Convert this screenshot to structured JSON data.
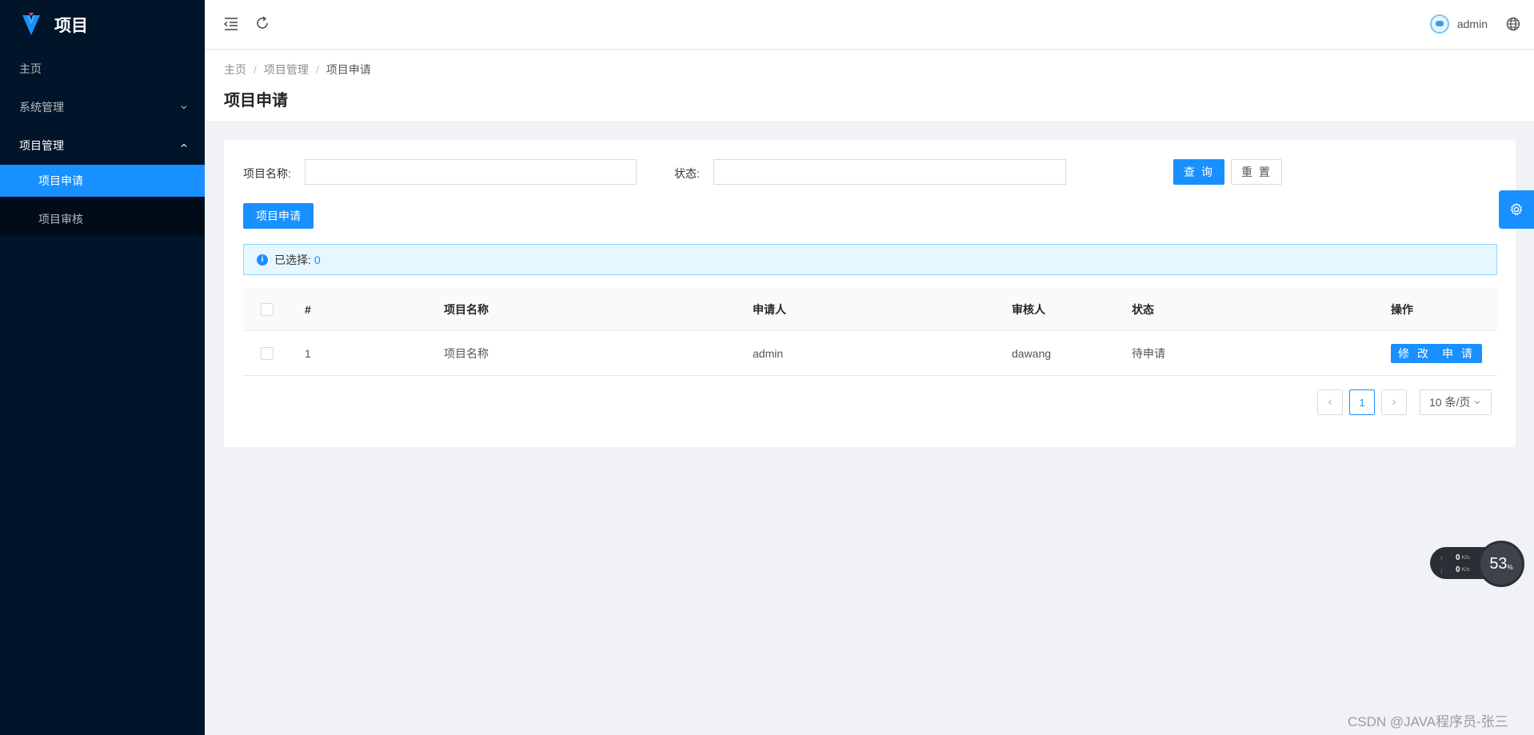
{
  "app": {
    "title": "项目",
    "brand_color": "#1890ff"
  },
  "sidebar": {
    "items": [
      {
        "label": "主页"
      },
      {
        "label": "系统管理"
      },
      {
        "label": "项目管理"
      }
    ],
    "submenu": [
      {
        "label": "项目申请",
        "active": true
      },
      {
        "label": "项目审核",
        "active": false
      }
    ]
  },
  "header": {
    "user_name": "admin"
  },
  "breadcrumb": {
    "home": "主页",
    "section": "项目管理",
    "current": "项目申请",
    "separator": "/"
  },
  "page": {
    "title": "项目申请"
  },
  "search": {
    "name_label": "项目名称:",
    "name_value": "",
    "status_label": "状态:",
    "status_value": "",
    "query_label": "查 询",
    "reset_label": "重 置"
  },
  "toolbar": {
    "apply_label": "项目申请"
  },
  "selection": {
    "label": "已选择:",
    "count": "0"
  },
  "table": {
    "columns": [
      "#",
      "项目名称",
      "申请人",
      "审核人",
      "状态",
      "操作"
    ],
    "rows": [
      {
        "index": "1",
        "name": "项目名称",
        "applicant": "admin",
        "reviewer": "dawang",
        "status": "待申请",
        "edit_label": "修 改",
        "apply_label": "申 请"
      }
    ]
  },
  "pagination": {
    "current_page": "1",
    "page_size": "10 条/页"
  },
  "net_widget": {
    "upload": "0",
    "download": "0",
    "unit": "K/s",
    "percent": "53",
    "percent_sign": "%"
  },
  "watermark": "CSDN @JAVA程序员-张三"
}
